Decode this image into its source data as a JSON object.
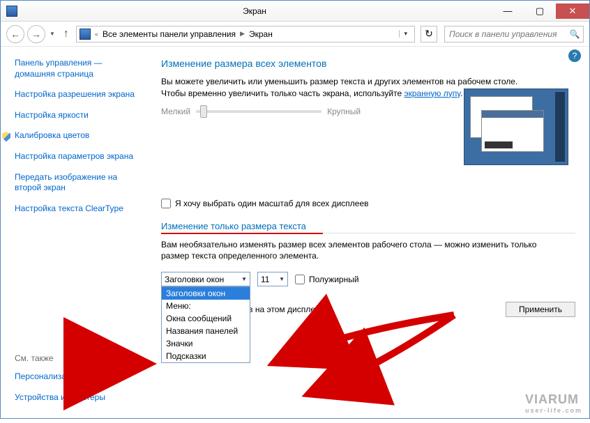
{
  "window": {
    "title": "Экран"
  },
  "toolbar": {
    "breadcrumb": [
      "Все элементы панели управления",
      "Экран"
    ],
    "search_placeholder": "Поиск в панели управления"
  },
  "sidebar": {
    "links": [
      "Панель управления — домашняя страница",
      "Настройка разрешения экрана",
      "Настройка яркости",
      "Калибровка цветов",
      "Настройка параметров экрана",
      "Передать изображение на второй экран",
      "Настройка текста ClearType"
    ],
    "see_also_label": "См. также",
    "see_also": [
      "Персонализация",
      "Устройства и принтеры"
    ]
  },
  "content": {
    "heading1": "Изменение размера всех элементов",
    "desc1_a": "Вы можете увеличить или уменьшить размер текста и других элементов на рабочем столе. Чтобы временно увеличить только часть экрана, используйте ",
    "desc1_link": "экранную лупу",
    "desc1_b": ".",
    "slider_min": "Мелкий",
    "slider_max": "Крупный",
    "checkbox1": "Я хочу выбрать один масштаб для всех дисплеев",
    "heading2": "Изменение только размера текста",
    "desc2": "Вам необязательно изменять размер всех элементов рабочего стола — можно изменить только размер текста определенного элемента.",
    "combo_item_value": "Заголовки окон",
    "combo_item_options": [
      "Заголовки окон",
      "Меню:",
      "Окна сообщений",
      "Названия панелей",
      "Значки",
      "Подсказки"
    ],
    "combo_size_value": "11",
    "bold_label": "Полужирный",
    "apply_msg_fragment": "нить размер элементов на этом дисплее.",
    "apply_button": "Применить"
  },
  "watermark": {
    "brand": "VIARUM",
    "sub": "user-life.com"
  }
}
